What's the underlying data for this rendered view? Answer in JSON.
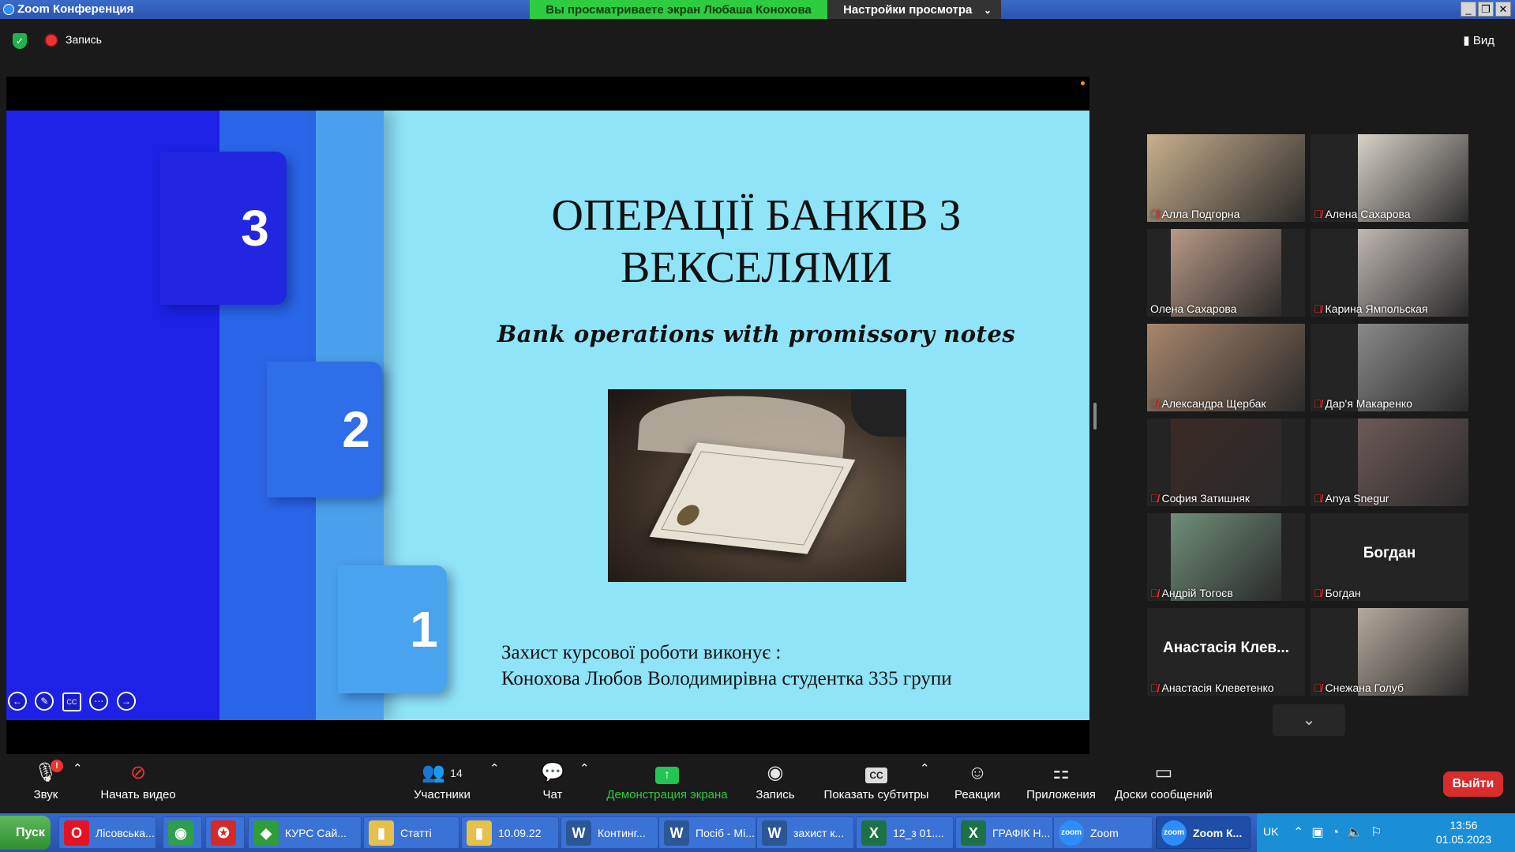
{
  "window": {
    "title": "Zoom Конференция",
    "share_banner": "Вы просматриваете экран Любаша  Конохова",
    "view_settings": "Настройки просмотра",
    "controls": [
      "_",
      "❐",
      "✕"
    ]
  },
  "top": {
    "record_label": "Запись",
    "view_label": "Вид"
  },
  "slide": {
    "tabs": [
      "3",
      "2",
      "1"
    ],
    "title_line1": "ОПЕРАЦІЇ БАНКІВ З",
    "title_line2": "ВЕКСЕЛЯМИ",
    "subtitle": "Bank operations with promissory notes",
    "footer_line1": "Захист курсової роботи виконує :",
    "footer_line2": "Конохова Любов Володимирівна студентка 335 групи",
    "tools": [
      "←",
      "✎",
      "CC",
      "⋯",
      "→"
    ]
  },
  "gallery": [
    {
      "name": "Алла Подгорна",
      "muted": true,
      "video": "#c9b08e"
    },
    {
      "name": "Алена Сахарова",
      "muted": true,
      "video": "#d8d2c8"
    },
    {
      "name": "Олена Сахарова",
      "muted": false,
      "video": "#b89a86"
    },
    {
      "name": "Карина Ямпольская",
      "muted": true,
      "video": "#bfb7b2"
    },
    {
      "name": "Александра Щербак",
      "muted": true,
      "video": "#a8866c"
    },
    {
      "name": "Дар'я Макаренко",
      "muted": true,
      "video": "#8a8a8a"
    },
    {
      "name": "София Затишняк",
      "muted": true,
      "video": "#3a2a26"
    },
    {
      "name": "Anya Snegur",
      "muted": true,
      "video": "#6d5a58"
    },
    {
      "name": "Андрій Тогоєв",
      "muted": true,
      "video": "#6f8f7a"
    },
    {
      "name": "Богдан",
      "muted": true,
      "big": "Богдан"
    },
    {
      "name": "Анастасія Клеветенко",
      "muted": true,
      "big": "Анастасія  Клев..."
    },
    {
      "name": "Снежана Голуб",
      "muted": true,
      "video": "#b5aa9c"
    }
  ],
  "toolbar": {
    "audio": "Звук",
    "audio_badge": "!",
    "video": "Начать видео",
    "participants": "Участники",
    "participants_count": "14",
    "chat": "Чат",
    "share": "Демонстрация экрана",
    "record": "Запись",
    "captions": "Показать субтитры",
    "captions_icon": "CC",
    "reactions": "Реакции",
    "apps": "Приложения",
    "whiteboards": "Доски сообщений",
    "leave": "Выйти"
  },
  "taskbar": {
    "start": "Пуск",
    "items": [
      {
        "label": "Лісовська...",
        "icon": "O",
        "color": "#e81123"
      },
      {
        "label": "",
        "icon": "◉",
        "color": "#2e9e4f"
      },
      {
        "label": "",
        "icon": "✪",
        "color": "#d42a2a"
      },
      {
        "label": "КУРС Сай...",
        "icon": "◆",
        "color": "#2f9e3a"
      },
      {
        "label": "Статті",
        "icon": "▮",
        "color": "#e5c04b"
      },
      {
        "label": "10.09.22",
        "icon": "▮",
        "color": "#e5c04b"
      },
      {
        "label": "Континг...",
        "icon": "W",
        "color": "#2b5797"
      },
      {
        "label": "Посіб - Mi...",
        "icon": "W",
        "color": "#2b5797"
      },
      {
        "label": "захист к...",
        "icon": "W",
        "color": "#2b5797"
      },
      {
        "label": "12_з 01....",
        "icon": "X",
        "color": "#1e7145"
      },
      {
        "label": "ГРАФІК Н...",
        "icon": "X",
        "color": "#1e7145"
      },
      {
        "label": "Zoom",
        "icon": "zoom",
        "color": "#2d8cff"
      },
      {
        "label": "Zoom К...",
        "icon": "zoom",
        "color": "#2d8cff",
        "active": true
      }
    ],
    "lang": "UK",
    "time": "13:56",
    "date": "01.05.2023"
  }
}
